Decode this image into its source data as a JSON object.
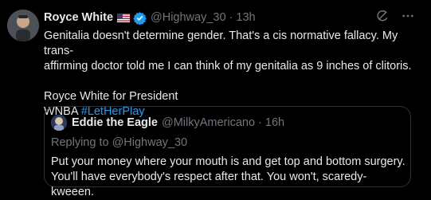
{
  "tweet": {
    "author_name": "Royce White",
    "flag_icon": "us-flag-icon",
    "handle": "@Highway_30",
    "separator": "·",
    "time": "13h",
    "text_lines": [
      "Genitalia doesn't determine gender. That's a cis normative fallacy. My trans-",
      "affirming doctor told me I can think of my genitalia as 9 inches of clitoris."
    ],
    "line3": "Royce White for President",
    "line4_prefix": "WNBA ",
    "hashtag": "#LetHerPlay"
  },
  "quote": {
    "author_name": "Eddie the Eagle",
    "handle": "@MilkyAmericano",
    "separator": "·",
    "time": "16h",
    "replying_to": "Replying to @Highway_30",
    "text_lines": [
      "Put your money where your mouth is and get top and bottom surgery.",
      "You'll have everybody's respect after that. You won't, scaredy-kweeen."
    ]
  },
  "colors": {
    "background": "#000000",
    "text": "#e7e9ea",
    "muted": "#71767b",
    "accent": "#1d9bf0",
    "border": "#2f3336"
  },
  "icons": [
    "verified-badge-icon",
    "grok-icon",
    "more-icon"
  ]
}
